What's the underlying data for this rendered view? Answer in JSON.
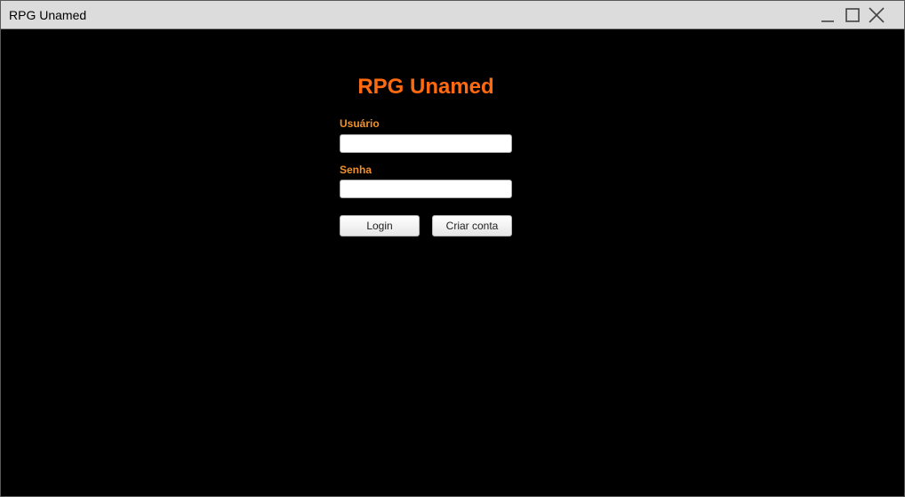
{
  "window": {
    "title": "RPG Unamed",
    "controls": [
      "minimize-icon",
      "maximize-icon",
      "close-icon"
    ]
  },
  "login": {
    "heading": "RPG Unamed",
    "username_label": "Usuário",
    "username_value": "",
    "password_label": "Senha",
    "password_value": "",
    "login_button": "Login",
    "create_account_button": "Criar conta"
  },
  "colors": {
    "background": "#000000",
    "titlebar": "#dcdcdc",
    "heading": "#ff6a10",
    "label": "#f0902a"
  }
}
